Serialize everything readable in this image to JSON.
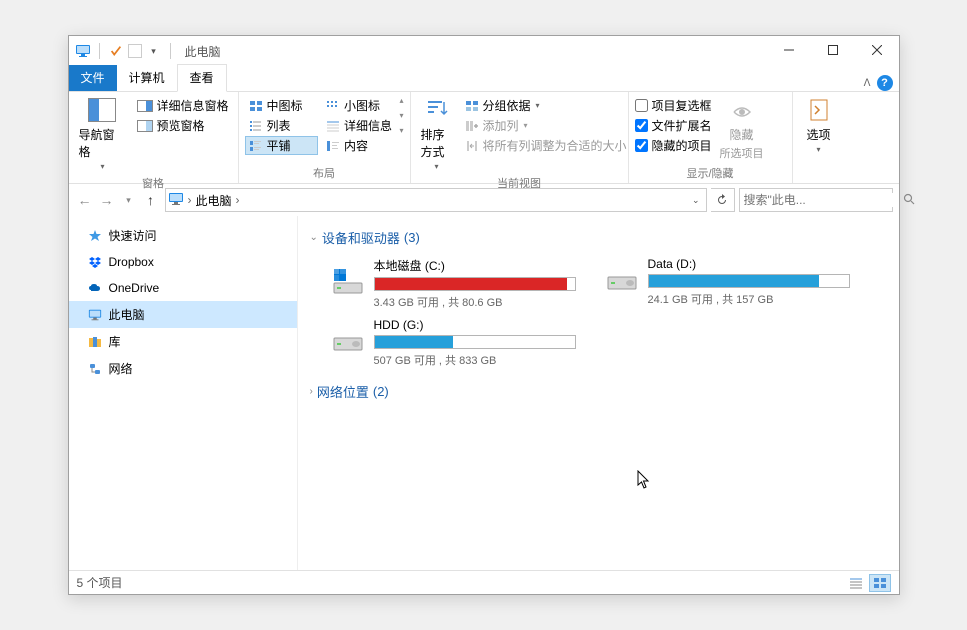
{
  "window": {
    "title": "此电脑"
  },
  "tabs": {
    "file": "文件",
    "computer": "计算机",
    "view": "查看"
  },
  "ribbon": {
    "panes": {
      "nav_pane": "导航窗格",
      "preview_pane": "预览窗格",
      "details_pane": "详细信息窗格",
      "group_label": "窗格"
    },
    "layout": {
      "medium_icons": "中图标",
      "small_icons": "小图标",
      "list": "列表",
      "details": "详细信息",
      "tiles": "平铺",
      "content": "内容",
      "group_label": "布局"
    },
    "current_view": {
      "sort_by": "排序方式",
      "group_by": "分组依据",
      "add_columns": "添加列",
      "size_all_columns": "将所有列调整为合适的大小",
      "group_label": "当前视图"
    },
    "show_hide": {
      "item_checkboxes": "项目复选框",
      "file_ext": "文件扩展名",
      "hidden_items": "隐藏的项目",
      "hide_selected": "隐藏",
      "hide_selected_sub": "所选项目",
      "group_label": "显示/隐藏"
    },
    "options": {
      "label": "选项"
    }
  },
  "nav": {
    "location": "此电脑",
    "separator": "›"
  },
  "search": {
    "placeholder": "搜索\"此电..."
  },
  "sidebar": {
    "items": [
      {
        "label": "快速访问"
      },
      {
        "label": "Dropbox"
      },
      {
        "label": "OneDrive"
      },
      {
        "label": "此电脑"
      },
      {
        "label": "库"
      },
      {
        "label": "网络"
      }
    ]
  },
  "sections": {
    "devices": {
      "label": "设备和驱动器",
      "count": "(3)"
    },
    "network": {
      "label": "网络位置",
      "count": "(2)"
    }
  },
  "drives": [
    {
      "name": "本地磁盘 (C:)",
      "status": "3.43 GB 可用 , 共 80.6 GB",
      "fill": 96,
      "color": "red",
      "system": true
    },
    {
      "name": "Data (D:)",
      "status": "24.1 GB 可用 , 共 157 GB",
      "fill": 85,
      "color": "blue",
      "system": false
    },
    {
      "name": "HDD (G:)",
      "status": "507 GB 可用 , 共 833 GB",
      "fill": 39,
      "color": "blue",
      "system": false
    }
  ],
  "statusbar": {
    "items": "5 个项目"
  }
}
